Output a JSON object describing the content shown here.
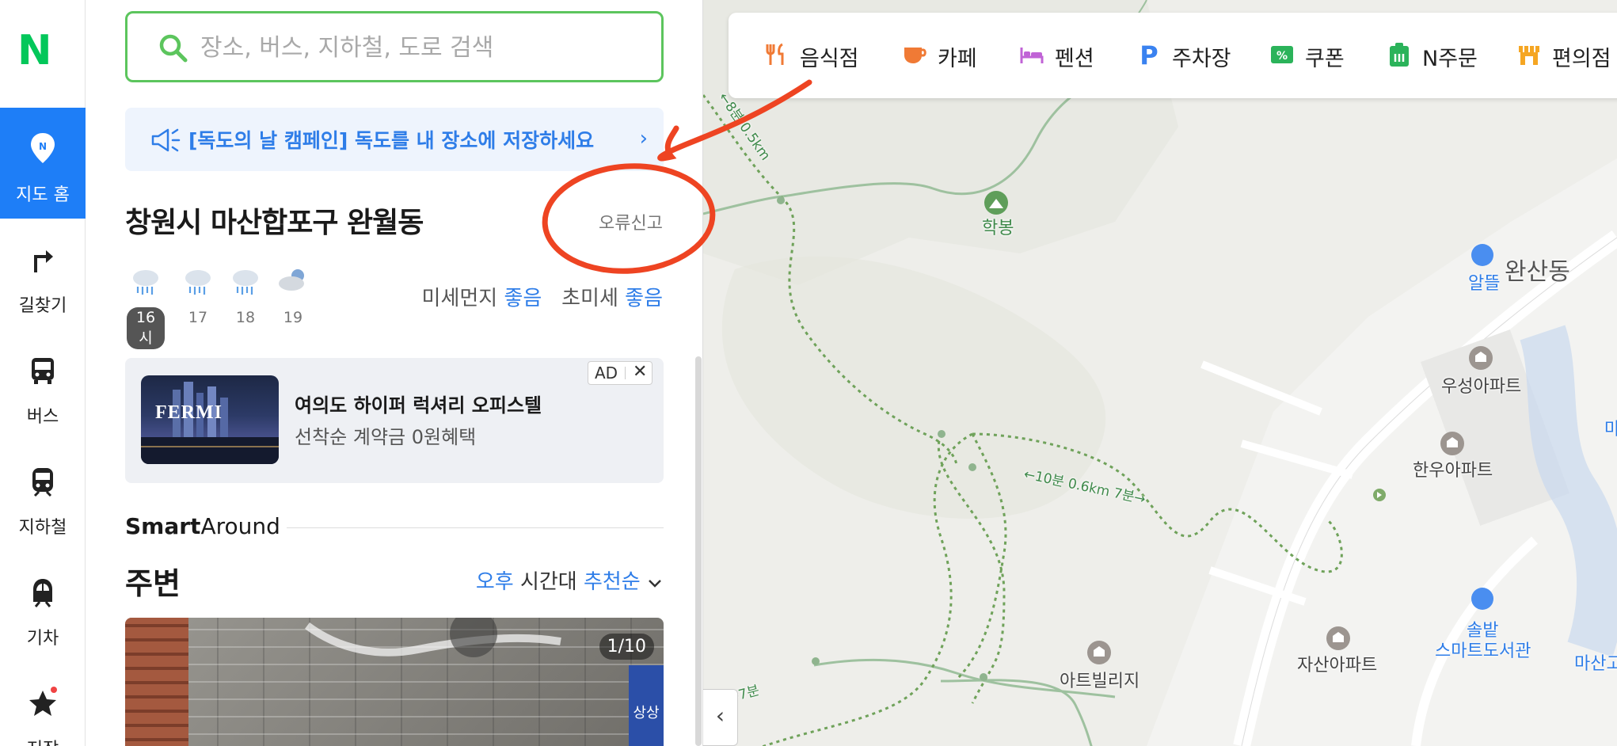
{
  "logo": "N",
  "nav": {
    "items": [
      {
        "label": "지도 홈",
        "icon": "map-pin-icon",
        "active": true
      },
      {
        "label": "길찾기",
        "icon": "turn-arrow-icon"
      },
      {
        "label": "버스",
        "icon": "bus-icon"
      },
      {
        "label": "지하철",
        "icon": "subway-icon"
      },
      {
        "label": "기차",
        "icon": "train-icon"
      },
      {
        "label": "저장",
        "icon": "star-icon"
      }
    ]
  },
  "search": {
    "placeholder": "장소, 버스, 지하철, 도로 검색",
    "value": ""
  },
  "campaign": {
    "text": "[독도의 날 캠페인] 독도를 내 장소에 저장하세요",
    "chevron": "›"
  },
  "location": {
    "title": "창원시 마산합포구 완월동",
    "report": "오류신고"
  },
  "weather": {
    "hours": [
      {
        "label": "16시",
        "icon": "rain-icon",
        "current": true
      },
      {
        "label": "17",
        "icon": "rain-icon"
      },
      {
        "label": "18",
        "icon": "rain-icon"
      },
      {
        "label": "19",
        "icon": "cloudy-night-icon"
      }
    ],
    "dust_label": "미세먼지",
    "dust_value": "좋음",
    "fine_dust_label": "초미세",
    "fine_dust_value": "좋음"
  },
  "ad": {
    "badge": "AD",
    "close": "✕",
    "image_brand": "FERMI",
    "title": "여의도 하이퍼 럭셔리 오피스텔",
    "subtitle": "선착순 계약금 0원혜택"
  },
  "smart_around": {
    "bold": "Smart",
    "rest": "Around"
  },
  "nearby": {
    "title": "주변",
    "time_of_day": "오후",
    "time_suffix": "시간대",
    "sort": "추천순",
    "photo_counter": "1/10",
    "photo_sign": "상상"
  },
  "categories": [
    {
      "label": "음식점",
      "icon": "restaurant-icon",
      "color": "#f07a35"
    },
    {
      "label": "카페",
      "icon": "coffee-icon",
      "color": "#f07a35"
    },
    {
      "label": "펜션",
      "icon": "bed-icon",
      "color": "#c063d6"
    },
    {
      "label": "주차장",
      "icon": "parking-icon",
      "color": "#3a82f0"
    },
    {
      "label": "쿠폰",
      "icon": "coupon-icon",
      "color": "#2bb35a"
    },
    {
      "label": "N주문",
      "icon": "order-icon",
      "color": "#2bb35a"
    },
    {
      "label": "편의점",
      "icon": "convenience-store-icon",
      "color": "#f5a623"
    }
  ],
  "map": {
    "labels": {
      "peak": "학봉",
      "dong": "완산동",
      "gas": "알뜰",
      "apt1": "우성아파트",
      "apt2": "한우아파트",
      "apt3": "자산아파트",
      "villa": "아트빌리지",
      "library1": "솔밭",
      "library2": "스마트도서관",
      "masan": "마산고",
      "trail1": "←10분 0.6km 7분→",
      "trail2": "←8분 0.5km",
      "trail3": "←7분",
      "m_edge": "마"
    }
  },
  "collapse": "‹"
}
